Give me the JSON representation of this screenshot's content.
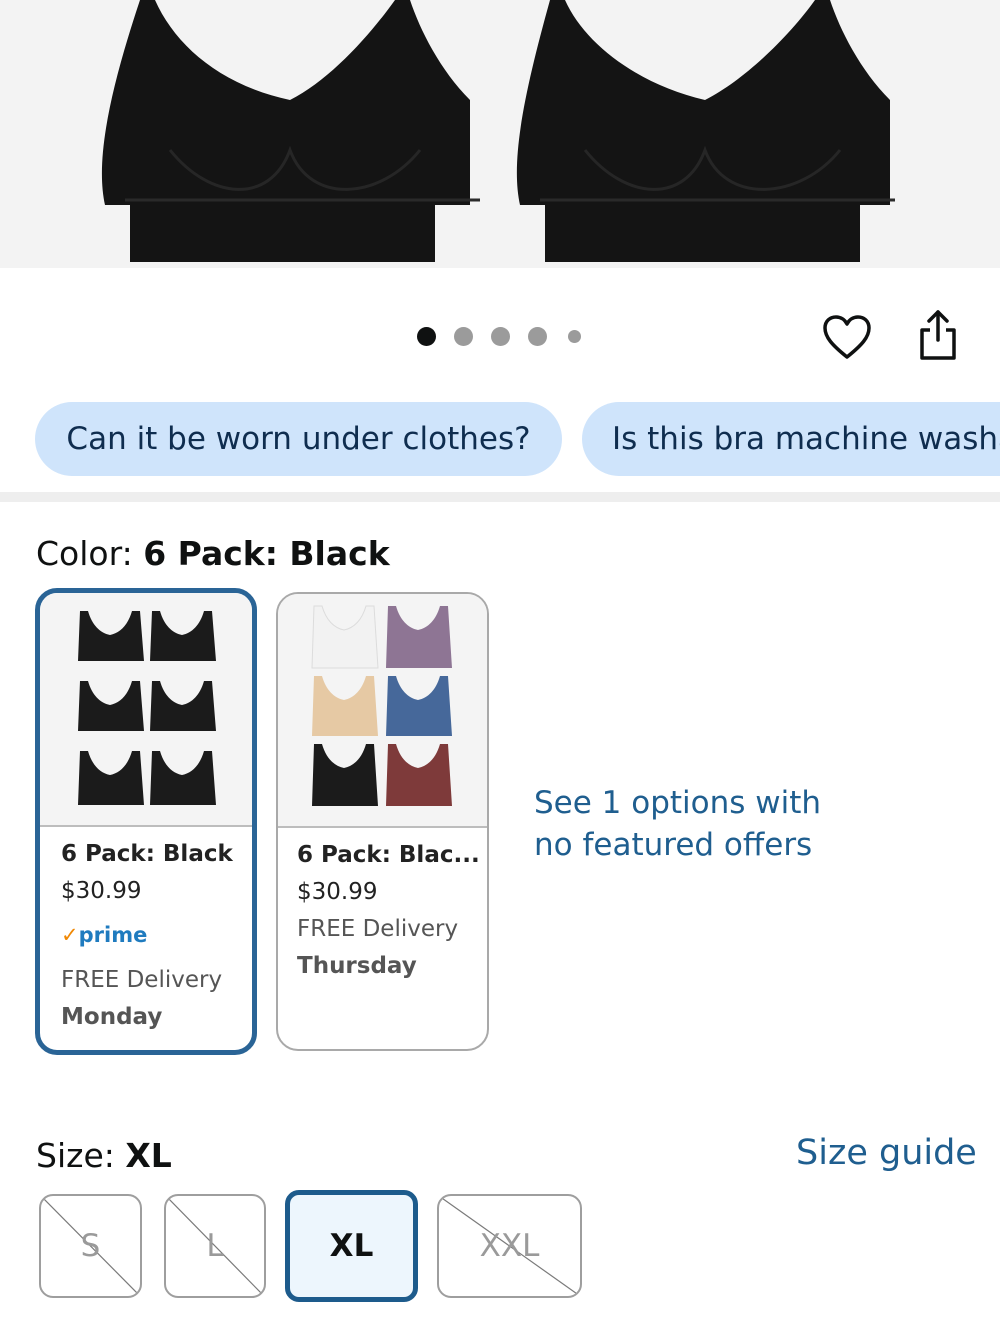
{
  "questions": [
    "Can it be worn under clothes?",
    "Is this bra machine washable?"
  ],
  "carousel": {
    "total": 5,
    "active_index": 0
  },
  "color_section": {
    "label": "Color: ",
    "selected_value": "6 Pack: Black",
    "swatches": [
      {
        "name": "6 Pack: Black",
        "price": "$30.99",
        "prime_badge": "prime",
        "delivery_label": "FREE Delivery",
        "delivery_day": "Monday",
        "selected": true
      },
      {
        "name": "6 Pack: Blac...",
        "price": "$30.99",
        "delivery_label": "FREE Delivery",
        "delivery_day": "Thursday",
        "selected": false
      }
    ],
    "see_options_link": "See 1 options with no featured offers"
  },
  "size_section": {
    "label": "Size: ",
    "selected_value": "XL",
    "size_guide_link": "Size guide",
    "sizes": [
      {
        "label": "S",
        "available": false
      },
      {
        "label": "L",
        "available": false
      },
      {
        "label": "XL",
        "available": true,
        "selected": true
      },
      {
        "label": "XXL",
        "available": false
      }
    ]
  },
  "colors": {
    "accent_link": "#1f5e8f",
    "selected_border": "#2a6496",
    "chip_background": "#cfe4fb",
    "prime_blue": "#1f7bbf",
    "prime_check": "#f08804"
  },
  "icons": [
    "heart-icon",
    "share-icon",
    "check-icon"
  ]
}
